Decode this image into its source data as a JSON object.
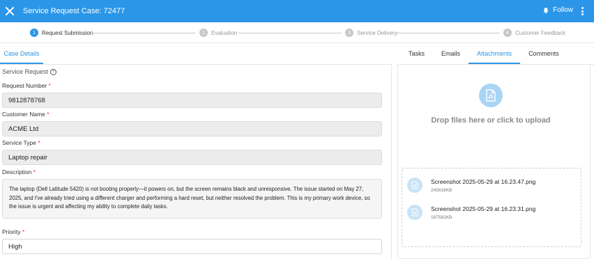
{
  "header": {
    "title": "Service Request Case: 72477",
    "follow_label": "Follow"
  },
  "stepper": {
    "steps": [
      {
        "num": "1",
        "label": "Request Submission",
        "active": true
      },
      {
        "num": "2",
        "label": "Evaluation",
        "active": false
      },
      {
        "num": "3",
        "label": "Service Delivery",
        "active": false
      },
      {
        "num": "4",
        "label": "Customer Feedback",
        "active": false
      }
    ]
  },
  "left_tab": "Case Details",
  "form": {
    "section_title": "Service Request",
    "help_glyph": "?",
    "required_mark": "*",
    "request_number": {
      "label": "Request Number",
      "value": "9812878768"
    },
    "customer_name": {
      "label": "Customer Name",
      "value": "ACME Ltd"
    },
    "service_type": {
      "label": "Service Type",
      "value": "Laptop repair"
    },
    "description": {
      "label": "Description",
      "value": "The laptop (Dell Latitude 5420) is not booting properly—it powers on, but the screen remains black and unresponsive. The issue started on May 27, 2025, and I've already tried using a different charger and performing a hard reset, but neither resolved the problem. This is my primary work device, so the issue is urgent and affecting my ability to complete daily tasks."
    },
    "priority": {
      "label": "Priority",
      "value": "High"
    }
  },
  "right_tabs": [
    "Tasks",
    "Emails",
    "Attachments",
    "Comments"
  ],
  "active_right_tab": "Attachments",
  "upload": {
    "drop_text": "Drop files here or click to upload"
  },
  "files": [
    {
      "name": "Screenshot 2025-05-29 at 16.23.47.png",
      "size": "245816KB"
    },
    {
      "name": "Screenshot 2025-05-29 at 16.23.31.png",
      "size": "187582KB"
    }
  ],
  "colors": {
    "accent": "#2b96e8",
    "required": "#e53935"
  }
}
